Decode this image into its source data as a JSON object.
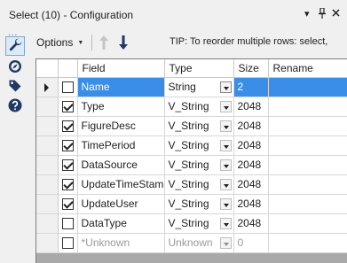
{
  "window": {
    "title": "Select (10) - Configuration"
  },
  "sidebar": {
    "dots": "...",
    "items": [
      {
        "name": "configuration-tab",
        "icon": "wrench-icon",
        "active": true
      },
      {
        "name": "annotation-tab",
        "icon": "compass-icon",
        "active": false
      },
      {
        "name": "tag-tab",
        "icon": "tag-icon",
        "active": false
      },
      {
        "name": "help-tab",
        "icon": "question-icon",
        "active": false
      }
    ]
  },
  "toolbar": {
    "options_label": "Options",
    "move_up_icon": "arrow-up-icon",
    "move_down_icon": "arrow-down-icon",
    "tip": "TIP: To reorder multiple rows: select,"
  },
  "grid": {
    "columns": [
      "Field",
      "Type",
      "Size",
      "Rename"
    ],
    "rows": [
      {
        "checked": false,
        "field": "Name",
        "type": "String",
        "size": "2",
        "rename": "",
        "selected": true,
        "disabled": false
      },
      {
        "checked": true,
        "field": "Type",
        "type": "V_String",
        "size": "2048",
        "rename": "",
        "selected": false,
        "disabled": false
      },
      {
        "checked": true,
        "field": "FigureDesc",
        "type": "V_String",
        "size": "2048",
        "rename": "",
        "selected": false,
        "disabled": false
      },
      {
        "checked": true,
        "field": "TimePeriod",
        "type": "V_String",
        "size": "2048",
        "rename": "",
        "selected": false,
        "disabled": false
      },
      {
        "checked": true,
        "field": "DataSource",
        "type": "V_String",
        "size": "2048",
        "rename": "",
        "selected": false,
        "disabled": false
      },
      {
        "checked": true,
        "field": "UpdateTimeStamp",
        "type": "V_String",
        "size": "2048",
        "rename": "",
        "selected": false,
        "disabled": false
      },
      {
        "checked": true,
        "field": "UpdateUser",
        "type": "V_String",
        "size": "2048",
        "rename": "",
        "selected": false,
        "disabled": false
      },
      {
        "checked": false,
        "field": "DataType",
        "type": "V_String",
        "size": "2048",
        "rename": "",
        "selected": false,
        "disabled": false
      },
      {
        "checked": false,
        "field": "*Unknown",
        "type": "Unknown",
        "size": "0",
        "rename": "",
        "selected": false,
        "disabled": true
      }
    ]
  },
  "colors": {
    "selection": "#3a8ee6",
    "active_tab": "#dce9f7"
  }
}
